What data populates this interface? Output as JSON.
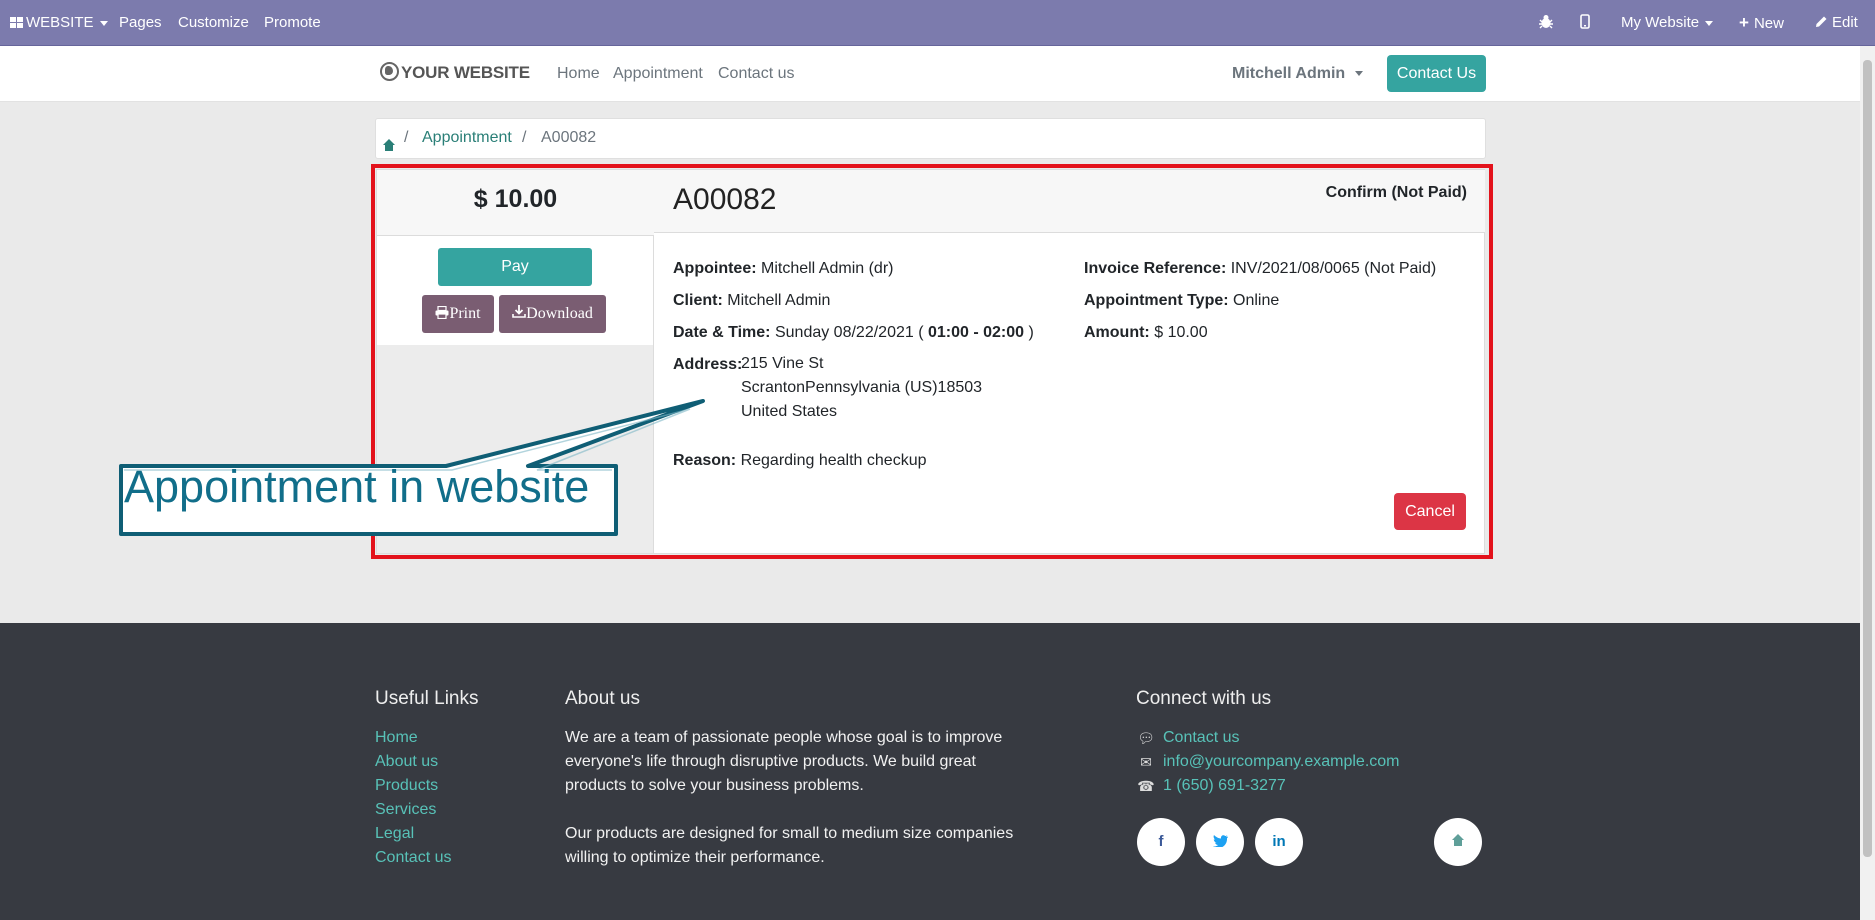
{
  "adminbar": {
    "website_label": "WEBSITE",
    "pages_label": "Pages",
    "customize_label": "Customize",
    "promote_label": "Promote",
    "my_website_label": "My Website",
    "new_label": "New",
    "edit_label": "Edit"
  },
  "header": {
    "logo_text": "YOUR WEBSITE",
    "nav": [
      "Home",
      "Appointment",
      "Contact us"
    ],
    "user_name": "Mitchell Admin",
    "contact_button": "Contact Us"
  },
  "breadcrumb": {
    "separator": "/",
    "items": [
      "Appointment",
      "A00082"
    ]
  },
  "appointment": {
    "amount": "$ 10.00",
    "pay_label": "Pay",
    "print_label": "Print",
    "download_label": "Download",
    "reference": "A00082",
    "state": "Confirm (Not Paid)",
    "appointee_label": "Appointee:",
    "appointee": "Mitchell Admin (dr)",
    "client_label": "Client:",
    "client": "Mitchell Admin",
    "datetime_label": "Date & Time:",
    "date": "Sunday 08/22/2021 (",
    "time": "01:00 - 02:00",
    "time_close": ")",
    "address_label": "Address:",
    "address_lines": [
      "215 Vine St",
      "ScrantonPennsylvania (US)18503",
      "United States"
    ],
    "reason_label": "Reason:",
    "reason": "Regarding health checkup",
    "invoice_label": "Invoice Reference:",
    "invoice": "INV/2021/08/0065 (Not Paid)",
    "type_label": "Appointment Type:",
    "type": "Online",
    "amount_label": "Amount:",
    "amount_value": "$ 10.00",
    "cancel_label": "Cancel"
  },
  "annotation": {
    "text": "Appointment in website",
    "frame_color": "#e3121b",
    "text_color": "#116e8a"
  },
  "footer": {
    "useful_links_title": "Useful Links",
    "useful_links": [
      "Home",
      "About us",
      "Products",
      "Services",
      "Legal",
      "Contact us"
    ],
    "about_title": "About us",
    "about_paragraphs": [
      "We are a team of passionate people whose goal is to improve everyone's life through disruptive products. We build great products to solve your business problems.",
      "Our products are designed for small to medium size companies willing to optimize their performance."
    ],
    "connect_title": "Connect with us",
    "connect_items": [
      {
        "icon": "comment-icon",
        "text": "Contact us"
      },
      {
        "icon": "envelope-icon",
        "text": "info@yourcompany.example.com"
      },
      {
        "icon": "phone-icon",
        "text": "1 (650) 691-3277"
      }
    ],
    "social": [
      "facebook-icon",
      "twitter-icon",
      "linkedin-icon",
      "home-icon"
    ]
  },
  "colors": {
    "adminbar": "#7c7bad",
    "primary": "#35a4a0",
    "secondary": "#7a5d72",
    "danger": "#dc3545",
    "footer": "#373a41",
    "link": "#2a7f77"
  }
}
